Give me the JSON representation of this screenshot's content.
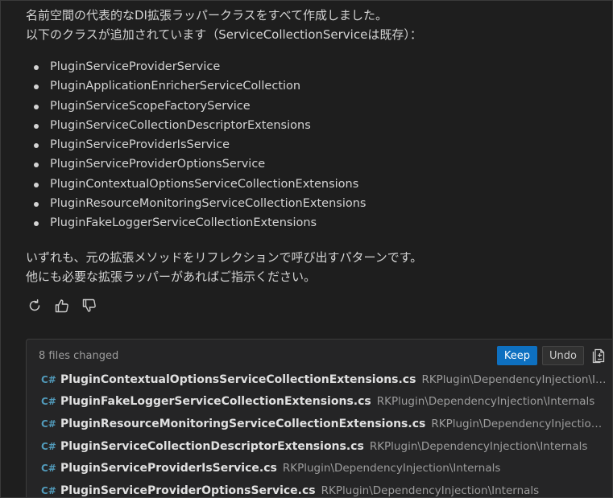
{
  "message": {
    "intro_lines": [
      "名前空間の代表的なDI拡張ラッパークラスをすべて作成しました。",
      "以下のクラスが追加されています（ServiceCollectionServiceは既存）："
    ],
    "items": [
      "PluginServiceProviderService",
      "PluginApplicationEnricherServiceCollection",
      "PluginServiceScopeFactoryService",
      "PluginServiceCollectionDescriptorExtensions",
      "PluginServiceProviderIsService",
      "PluginServiceProviderOptionsService",
      "PluginContextualOptionsServiceCollectionExtensions",
      "PluginResourceMonitoringServiceCollectionExtensions",
      "PluginFakeLoggerServiceCollectionExtensions"
    ],
    "outro_lines": [
      "いずれも、元の拡張メソッドをリフレクションで呼び出すパターンです。",
      "他にも必要な拡張ラッパーがあればご指示ください。"
    ]
  },
  "feedback": {
    "icons": [
      "retry-icon",
      "thumbs-up-icon",
      "thumbs-down-icon"
    ]
  },
  "changes": {
    "count_label": "8 files changed",
    "keep_label": "Keep",
    "undo_label": "Undo",
    "file_icon_glyph": "C#",
    "files": [
      {
        "name": "PluginContextualOptionsServiceCollectionExtensions.cs",
        "path": "RKPlugin\\DependencyInjection\\Int..."
      },
      {
        "name": "PluginFakeLoggerServiceCollectionExtensions.cs",
        "path": "RKPlugin\\DependencyInjection\\Internals"
      },
      {
        "name": "PluginResourceMonitoringServiceCollectionExtensions.cs",
        "path": "RKPlugin\\DependencyInjection\\I..."
      },
      {
        "name": "PluginServiceCollectionDescriptorExtensions.cs",
        "path": "RKPlugin\\DependencyInjection\\Internals"
      },
      {
        "name": "PluginServiceProviderIsService.cs",
        "path": "RKPlugin\\DependencyInjection\\Internals"
      },
      {
        "name": "PluginServiceProviderOptionsService.cs",
        "path": "RKPlugin\\DependencyInjection\\Internals"
      }
    ]
  },
  "colors": {
    "background": "#1e1e1e",
    "accent": "#0e70c0",
    "csharp_icon": "#519aba"
  }
}
